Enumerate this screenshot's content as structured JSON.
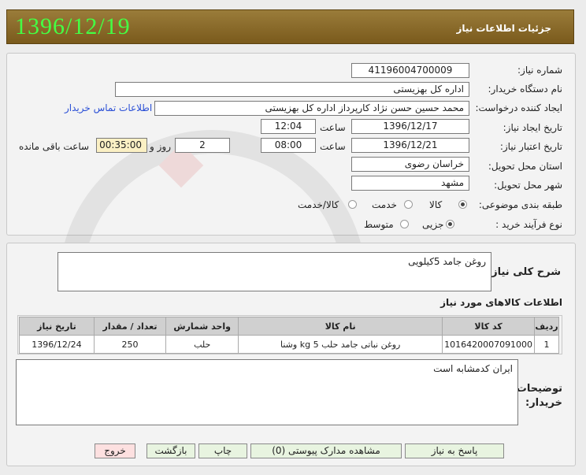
{
  "header": {
    "title": "جزئیات اطلاعات نیاز",
    "date": "1396/12/19"
  },
  "form": {
    "need_number_label": "شماره نیاز:",
    "need_number": "1196004700009‏4",
    "buyer_org_label": "نام دستگاه خریدار:",
    "buyer_org": "اداره کل بهزیستی",
    "requester_label": "ایجاد کننده درخواست:",
    "requester": "محمد حسین حسن نژاد کارپرداز اداره کل بهزیستی",
    "contact_link": "اطلاعات تماس خریدار",
    "created_label": "تاریخ ایجاد نیاز:",
    "created_date": "1396/12/17",
    "time_label": "ساعت",
    "created_time": "12:04",
    "validity_label": "تاریخ اعتبار نیاز:",
    "validity_date": "1396/12/21",
    "validity_time": "08:00",
    "days": "2",
    "days_label": "روز و",
    "remaining_time": "00:35:00",
    "remaining_label": "ساعت باقی مانده",
    "province_label": "استان محل تحویل:",
    "province": "خراسان رضوی",
    "city_label": "شهر محل تحویل:",
    "city": "مشهد",
    "category_label": "طبقه بندی موضوعی:",
    "category_options": [
      "کالا",
      "خدمت",
      "کالا/خدمت"
    ],
    "category_selected": 0,
    "process_label": "نوع فرآیند خرید :",
    "process_options": [
      "جزیی",
      "متوسط"
    ],
    "process_selected": 0
  },
  "summary": {
    "label": "شرح کلی نیاز:",
    "value": "روغن جامد 5کیلویی"
  },
  "items": {
    "title": "اطلاعات کالاهای مورد نیاز",
    "columns": [
      "ردیف",
      "کد کالا",
      "نام کالا",
      "واحد شمارش",
      "تعداد / مقدار",
      "تاریخ نیاز"
    ],
    "rows": [
      [
        "1",
        "016420007091000‏1",
        "روغن نباتی جامد حلب kg 5 وشنا",
        "حلب",
        "250",
        "1396/12/24"
      ]
    ]
  },
  "notes": {
    "label": "توضیحات خریدار:",
    "value": "ایران کدمشابه است"
  },
  "buttons": {
    "reply": "پاسخ به نیاز",
    "attachments": "مشاهده مدارک پیوستی (0)",
    "print": "چاپ",
    "back": "بازگشت",
    "exit": "خروج"
  },
  "colors": {
    "header_bg": "#8a6a2a",
    "date_text": "#44ff44",
    "link": "#2a4fd6",
    "exit_button": "#fde0e0",
    "button_bg": "#e8f4e0"
  }
}
